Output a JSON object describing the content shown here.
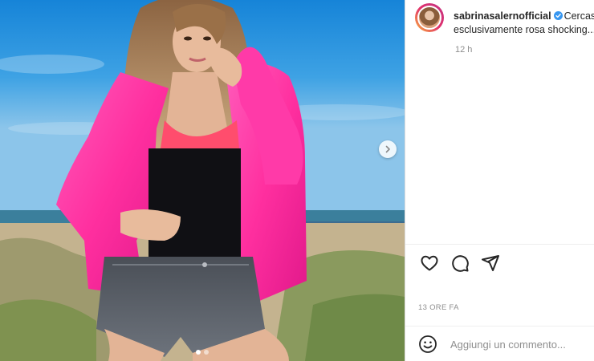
{
  "post": {
    "username": "sabrinasalernofficial",
    "caption_line1": "Cercasi",
    "caption_line2": "esclusivamente rosa shocking...",
    "time_short": "12 h",
    "time_full": "13 ORE FA"
  },
  "media": {
    "slide_count": 2,
    "active_slide": 1,
    "next_button_icon": "chevron-right-icon"
  },
  "actions": {
    "like_icon": "heart-icon",
    "comment_icon": "comment-icon",
    "share_icon": "paper-plane-icon"
  },
  "comment_box": {
    "placeholder": "Aggiungi un commento...",
    "value": "",
    "emoji_icon": "smiley-icon"
  },
  "colors": {
    "jacket_pink": "#ff3aa8",
    "verified_blue": "#3897f0",
    "meta_gray": "#8e8e8e"
  }
}
